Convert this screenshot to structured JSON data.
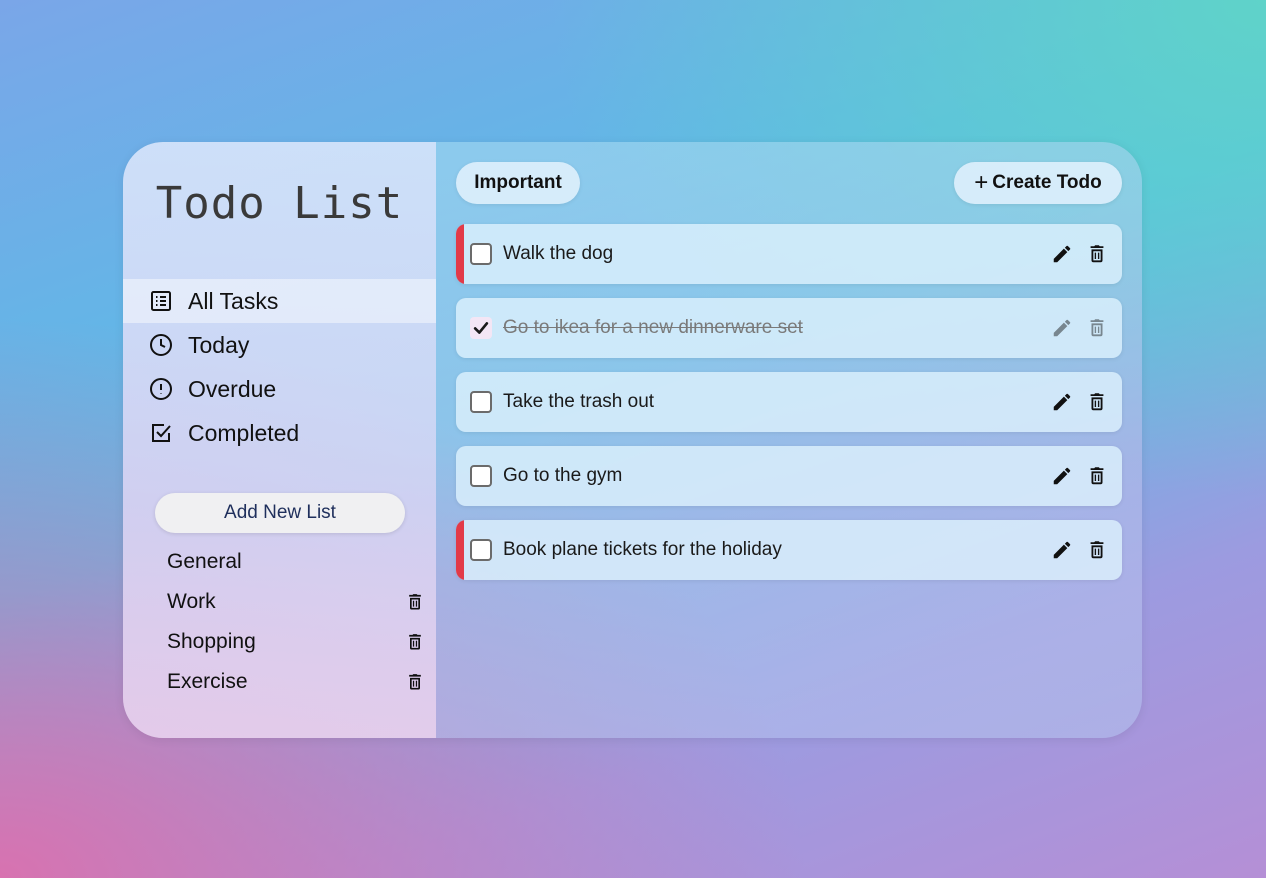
{
  "app": {
    "title": "Todo List"
  },
  "nav": {
    "items": [
      {
        "label": "All Tasks",
        "icon": "list-icon",
        "active": true
      },
      {
        "label": "Today",
        "icon": "clock-icon",
        "active": false
      },
      {
        "label": "Overdue",
        "icon": "alert-icon",
        "active": false
      },
      {
        "label": "Completed",
        "icon": "check-square-icon",
        "active": false
      }
    ]
  },
  "lists": {
    "add_label": "Add New List",
    "items": [
      {
        "label": "General",
        "deletable": false
      },
      {
        "label": "Work",
        "deletable": true
      },
      {
        "label": "Shopping",
        "deletable": true
      },
      {
        "label": "Exercise",
        "deletable": true
      }
    ]
  },
  "toolbar": {
    "important_label": "Important",
    "create_label": "Create Todo",
    "create_icon": "plus-icon"
  },
  "todos": [
    {
      "text": "Walk the dog",
      "important": true,
      "done": false
    },
    {
      "text": "Go to ikea for a new dinnerware set",
      "important": false,
      "done": true
    },
    {
      "text": "Take the trash out",
      "important": false,
      "done": false
    },
    {
      "text": "Go to the gym",
      "important": false,
      "done": false
    },
    {
      "text": "Book plane tickets for the holiday",
      "important": true,
      "done": false
    }
  ],
  "colors": {
    "important_accent": "#e23a48",
    "text": "#111111",
    "add_list_text": "#1f2f5c"
  }
}
